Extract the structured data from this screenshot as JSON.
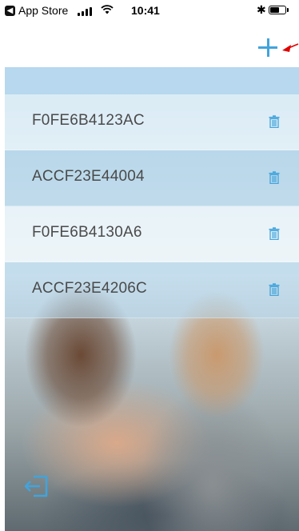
{
  "status_bar": {
    "back_app_label": "App Store",
    "back_badge": "◀",
    "time": "10:41",
    "bluetooth": "✱"
  },
  "nav": {
    "add_icon": "plus-icon"
  },
  "devices": [
    {
      "id": "F0FE6B4123AC"
    },
    {
      "id": "ACCF23E44004"
    },
    {
      "id": "F0FE6B4130A6"
    },
    {
      "id": "ACCF23E4206C"
    }
  ],
  "colors": {
    "accent": "#41a4dc",
    "annotation_arrow": "#e00000"
  }
}
